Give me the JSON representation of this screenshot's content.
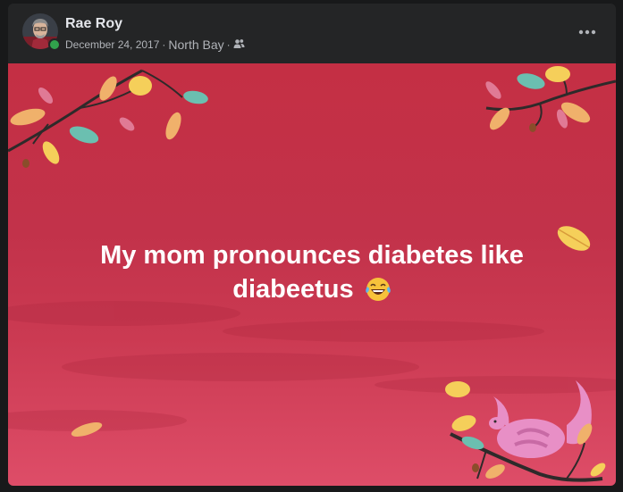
{
  "post": {
    "author": "Rae Roy",
    "date": "December 24, 2017",
    "location": "North Bay",
    "audience_icon": "friends-icon",
    "more_icon": "more-options-icon",
    "text": "My mom pronounces diabetes like diabeetus",
    "emoji": "tears-of-joy-emoji"
  },
  "colors": {
    "card_bg": "#242526",
    "banner": "#c42f44",
    "online": "#31a24c",
    "leaf_orange": "#f0b16b",
    "leaf_yellow": "#f5cf5a",
    "leaf_teal": "#6bbfb0",
    "leaf_pink": "#e07a95",
    "squirrel_pink": "#e88fc6"
  }
}
